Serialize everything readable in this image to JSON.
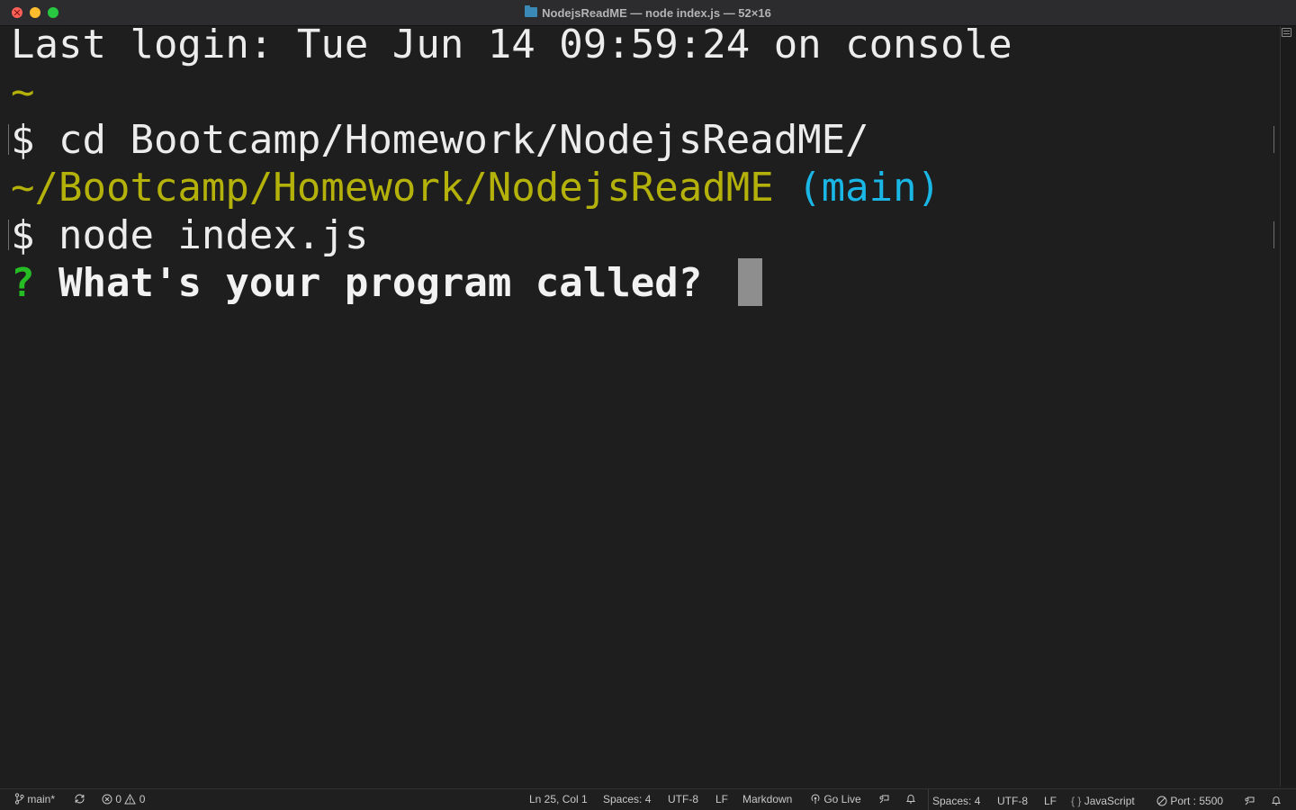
{
  "window": {
    "title": "NodejsReadME — node index.js — 52×16"
  },
  "terminal": {
    "login_line": "Last login: Tue Jun 14 09:59:24 on console",
    "tilde_line": "~",
    "cmd1": "$ cd Bootcamp/Homework/NodejsReadME/",
    "path": "~/Bootcamp/Homework/NodejsReadME",
    "branch": "(main)",
    "cmd2": "$ node index.js",
    "question_mark": "?",
    "question": "What's your program called?"
  },
  "statusbar": {
    "branch": "main*",
    "errors": "0",
    "warnings": "0",
    "position": "Ln 25, Col 1",
    "spaces": "Spaces: 4",
    "encoding": "UTF-8",
    "eol": "LF",
    "language": "Markdown",
    "go_live": "Go Live",
    "spaces2": "Spaces: 4",
    "encoding2": "UTF-8",
    "eol2": "LF",
    "language2": "JavaScript",
    "port": "Port : 5500"
  },
  "colors": {
    "background": "#1e1e1e",
    "path_yellow": "#b4b20a",
    "branch_cyan": "#19b6e6",
    "question_green": "#25bc24",
    "cursor": "#8e8e8e"
  }
}
